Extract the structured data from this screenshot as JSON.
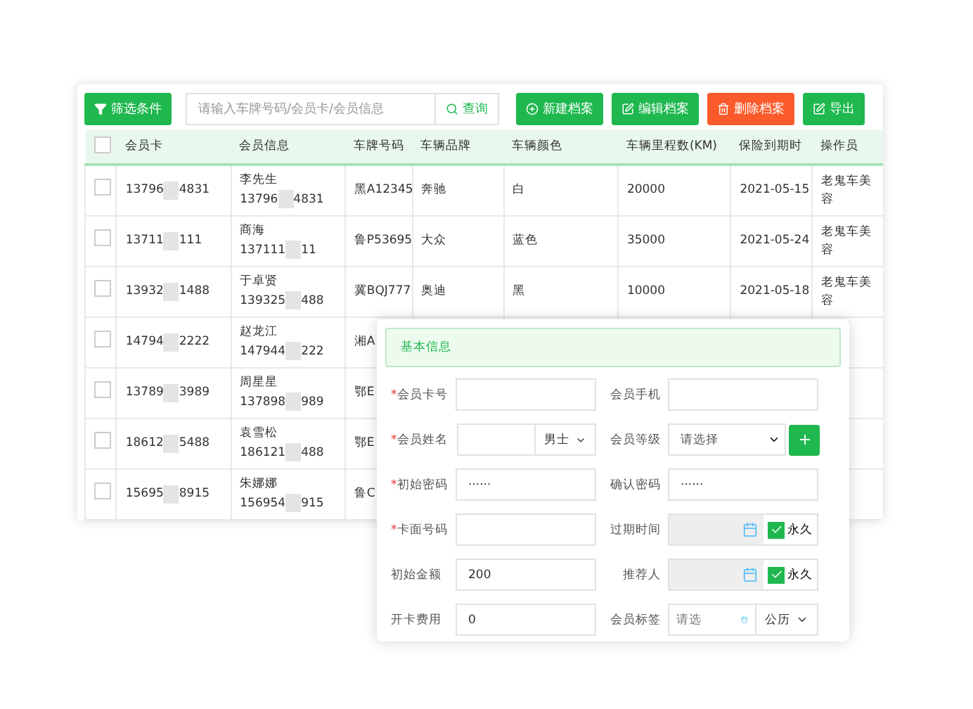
{
  "toolbar": {
    "filter_button": "筛选条件",
    "search": {
      "placeholder": "请输入车牌号码/会员卡/会员信息"
    },
    "search_button": "查询",
    "actions": [
      {
        "label": "新建档案",
        "kind": "add"
      },
      {
        "label": "编辑档案",
        "kind": "edit"
      },
      {
        "label": "删除档案",
        "kind": "delete"
      },
      {
        "label": "导出",
        "kind": "export"
      }
    ]
  },
  "table": {
    "header_checked": false,
    "columns": [
      "会员卡",
      "会员信息",
      "车牌号码",
      "车辆品牌",
      "车辆颜色",
      "车辆里程数(KM)",
      "保险到期时",
      "操作员"
    ],
    "rows": [
      {
        "checked": false,
        "card": [
          "13796",
          "4831"
        ],
        "name": "李先生",
        "phone": [
          "13796",
          "4831"
        ],
        "plate": "黑A12345",
        "brand": "奔驰",
        "vehicle_color": "白",
        "mileage": "20000",
        "expiry": "2021-05-15",
        "operator": "老鬼车美容"
      },
      {
        "checked": false,
        "card": [
          "13711",
          "111"
        ],
        "name": "商海",
        "phone": [
          "137111",
          "11"
        ],
        "plate": "鲁P53695",
        "brand": "大众",
        "vehicle_color": "蓝色",
        "mileage": "35000",
        "expiry": "2021-05-24",
        "operator": "老鬼车美容"
      },
      {
        "checked": false,
        "card": [
          "13932",
          "1488"
        ],
        "name": "于卓贤",
        "phone": [
          "139325",
          "488"
        ],
        "plate": "冀BQJ777",
        "brand": "奥迪",
        "vehicle_color": "黑",
        "mileage": "10000",
        "expiry": "2021-05-18",
        "operator": "老鬼车美容"
      },
      {
        "checked": false,
        "card": [
          "14794",
          "2222"
        ],
        "name": "赵龙江",
        "phone": [
          "147944",
          "222"
        ],
        "plate": "湘A"
      },
      {
        "checked": false,
        "card": [
          "13789",
          "3989"
        ],
        "name": "周星星",
        "phone": [
          "137898",
          "989"
        ],
        "plate": "鄂E"
      },
      {
        "checked": false,
        "card": [
          "18612",
          "5488"
        ],
        "name": "袁雪松",
        "phone": [
          "186121",
          "488"
        ],
        "plate": "鄂E"
      },
      {
        "checked": false,
        "card": [
          "15695",
          "8915"
        ],
        "name": "朱娜娜",
        "phone": [
          "156954",
          "915"
        ],
        "plate": "鲁C"
      }
    ]
  },
  "dialog": {
    "section": "基本信息",
    "fields": [
      {
        "label": "会员卡号",
        "mark": "*",
        "kind": "input"
      },
      {
        "label": "会员手机",
        "kind": "input"
      },
      {
        "label": "会员姓名",
        "mark": "*",
        "kind": "gender",
        "option": "男士"
      },
      {
        "label": "会员等级",
        "kind": "select_add",
        "placeholder": "请选择"
      },
      {
        "label": "初始密码",
        "mark": "*",
        "kind": "input",
        "value": "······"
      },
      {
        "label": "确认密码",
        "kind": "input",
        "value": "······"
      },
      {
        "label": "卡面号码",
        "mark": "*",
        "kind": "input"
      },
      {
        "label": "过期时间",
        "kind": "date_forever",
        "option": "永久",
        "checked": true
      },
      {
        "label": "初始金额",
        "kind": "input",
        "value": "200"
      },
      {
        "label": "推荐人",
        "kind": "date_forever",
        "option": "永久",
        "checked": true
      },
      {
        "label": "开卡费用",
        "kind": "input",
        "value": "0"
      },
      {
        "label": "会员标签",
        "kind": "date_era",
        "placeholder": "请选",
        "option": "公历"
      }
    ]
  }
}
